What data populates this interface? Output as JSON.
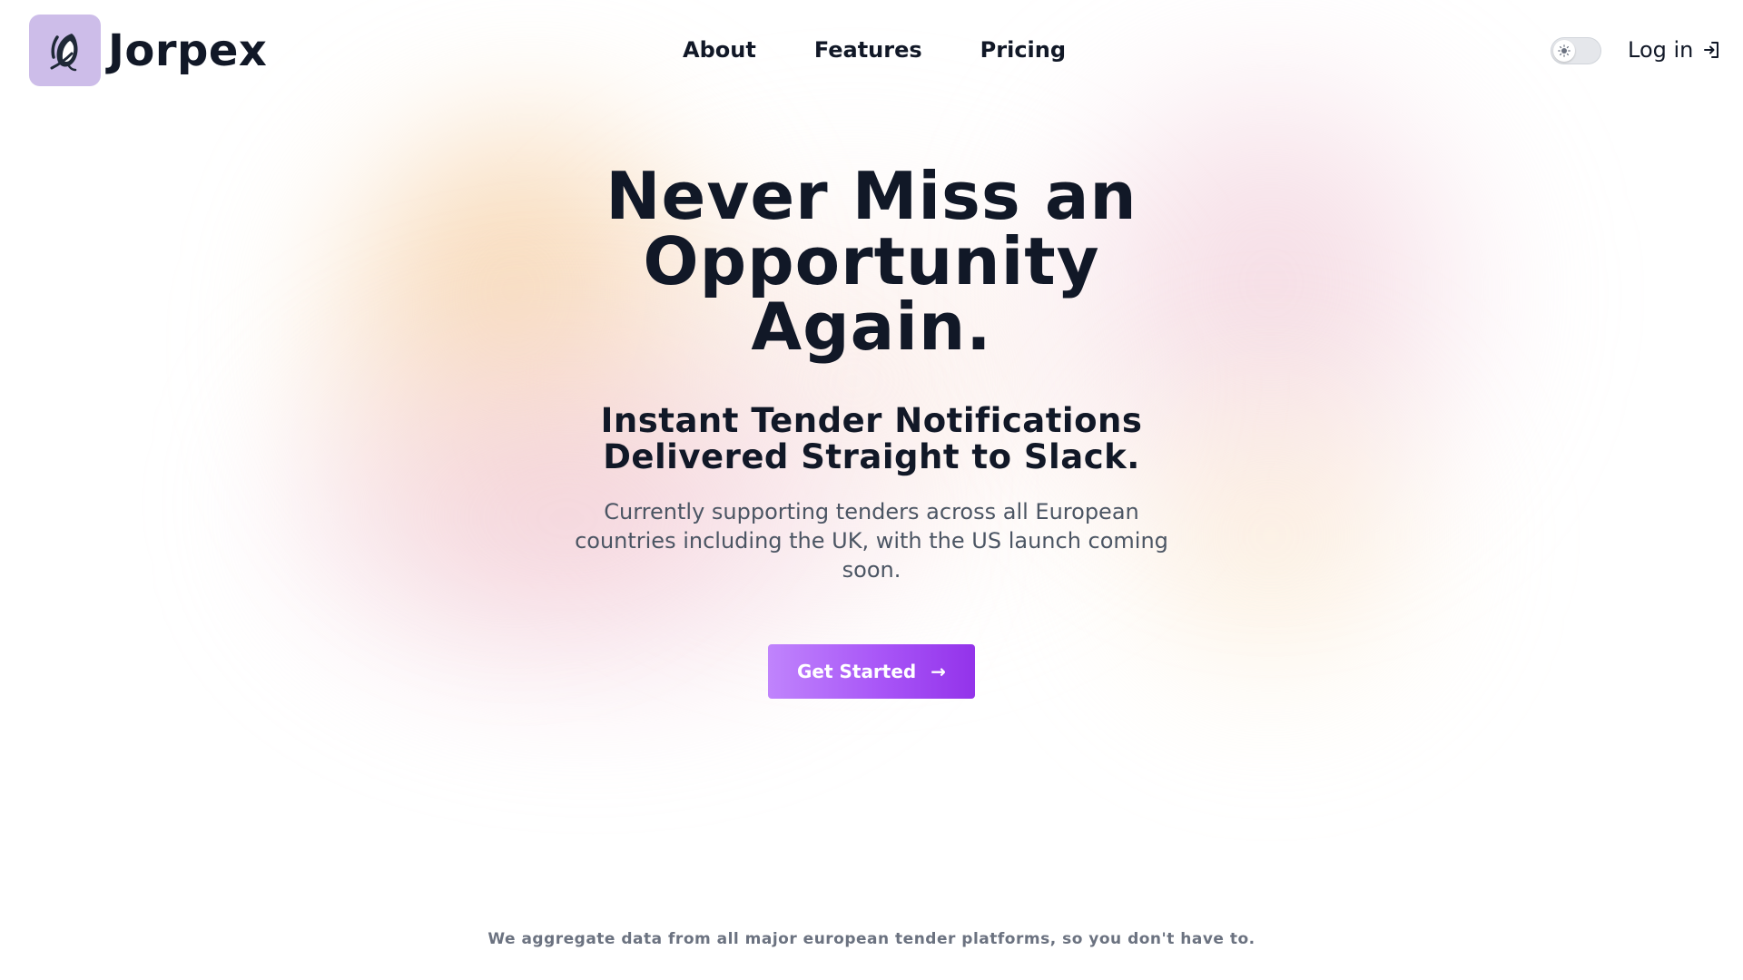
{
  "header": {
    "brand": "Jorpex",
    "logo_icon": "quill-feather-icon",
    "nav": [
      {
        "label": "About"
      },
      {
        "label": "Features"
      },
      {
        "label": "Pricing"
      }
    ],
    "theme_toggle_icon": "sun-icon",
    "login_label": "Log in",
    "login_icon": "log-in-icon"
  },
  "hero": {
    "title_lines": [
      "Never Miss an",
      "Opportunity",
      "Again."
    ],
    "subtitle_lines": [
      "Instant Tender Notifications",
      "Delivered Straight to Slack."
    ],
    "description": "Currently supporting tenders across all European countries including the UK, with the US launch coming soon.",
    "cta_label": "Get Started",
    "cta_arrow": "→"
  },
  "footer_note": "We aggregate data from all major european tender platforms, so you don't have to.",
  "colors": {
    "text_primary": "#111827",
    "text_secondary": "#4b5563",
    "text_muted": "#6b7280",
    "logo_bg": "#cdbde9",
    "cta_gradient_start": "#c084fc",
    "cta_gradient_end": "#9333ea"
  }
}
